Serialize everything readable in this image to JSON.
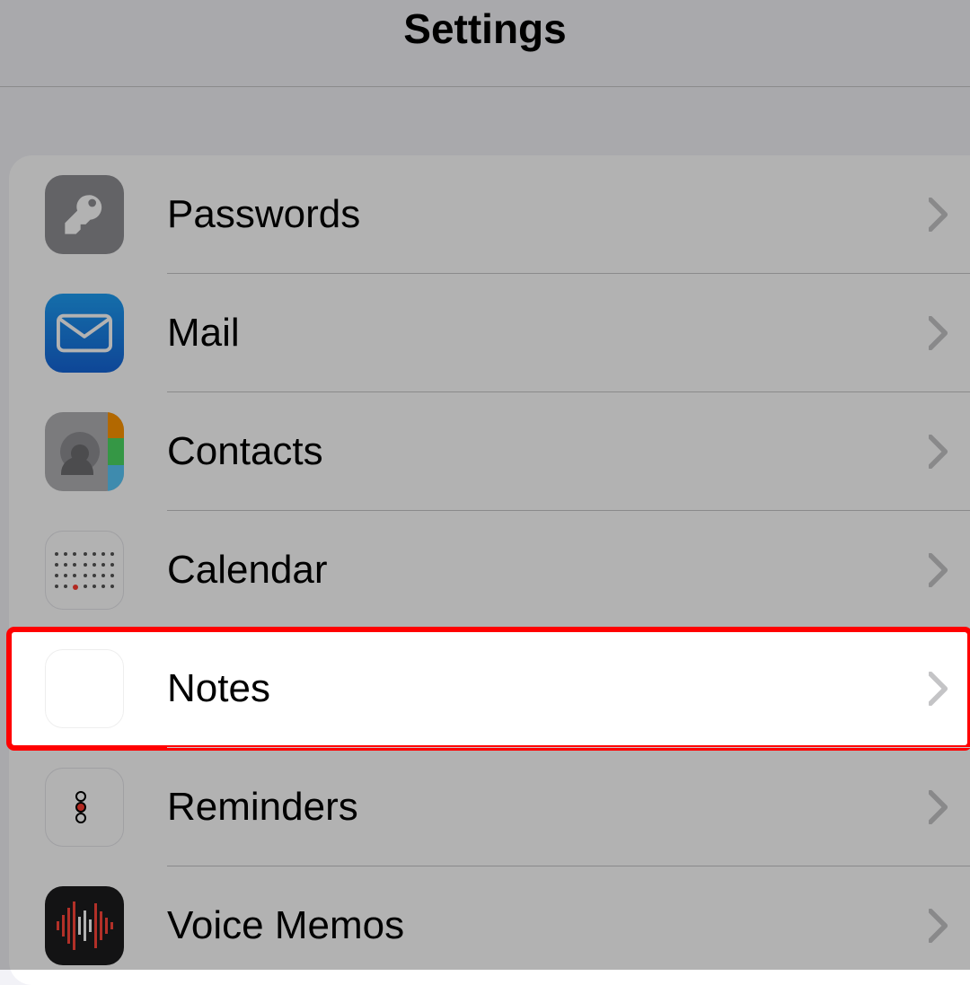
{
  "header": {
    "title": "Settings"
  },
  "items": [
    {
      "icon": "passwords",
      "label": "Passwords",
      "highlighted": false
    },
    {
      "icon": "mail",
      "label": "Mail",
      "highlighted": false
    },
    {
      "icon": "contacts",
      "label": "Contacts",
      "highlighted": false
    },
    {
      "icon": "calendar",
      "label": "Calendar",
      "highlighted": false
    },
    {
      "icon": "notes",
      "label": "Notes",
      "highlighted": true
    },
    {
      "icon": "reminders",
      "label": "Reminders",
      "highlighted": false
    },
    {
      "icon": "voicememos",
      "label": "Voice Memos",
      "highlighted": false
    }
  ]
}
